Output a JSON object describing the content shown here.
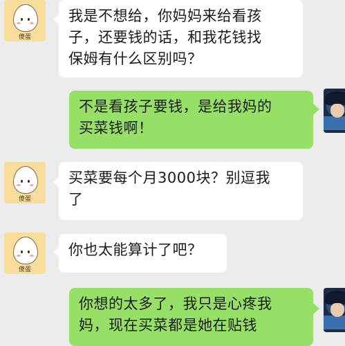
{
  "chat": {
    "messages": [
      {
        "side": "left",
        "lines": [
          "我是不想给，你妈妈来给看孩",
          "子，还要钱的话，和我花钱找",
          "保姆有什么区别吗？"
        ],
        "avatar_icon": "egg-character-avatar",
        "avatar_signature": "傻蛋"
      },
      {
        "side": "right",
        "lines": [
          "不是看孩子要钱，是给我妈的",
          "买菜钱啊！"
        ],
        "avatar_icon": "anime-boy-avatar"
      },
      {
        "side": "left",
        "lines": [
          "买菜要每个月3000块？别逗我",
          "了"
        ],
        "avatar_icon": "egg-character-avatar",
        "avatar_signature": "傻蛋"
      },
      {
        "side": "left",
        "lines": [
          "你也太能算计了吧？"
        ],
        "avatar_icon": "egg-character-avatar",
        "avatar_signature": "傻蛋"
      },
      {
        "side": "right",
        "lines": [
          "你想的太多了，我只是心疼我",
          "妈，现在买菜都是她在贴钱"
        ],
        "avatar_icon": "anime-boy-avatar"
      }
    ]
  },
  "colors": {
    "background": "#ececec",
    "incoming_bubble": "#ffffff",
    "outgoing_bubble": "#97e068"
  }
}
